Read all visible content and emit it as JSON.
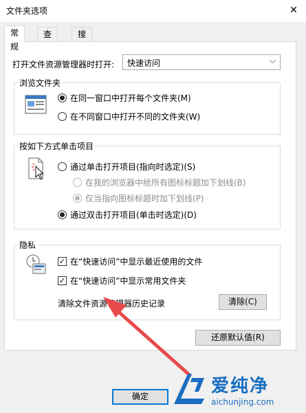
{
  "window": {
    "title": "文件夹选项",
    "close_glyph": "✕"
  },
  "tabs": [
    {
      "label": "常规",
      "active": true
    },
    {
      "label": "查看",
      "active": false
    },
    {
      "label": "搜索",
      "active": false
    }
  ],
  "open_with": {
    "label": "打开文件资源管理器时打开:",
    "value": "快速访问",
    "chevron": "⌵"
  },
  "browse": {
    "legend": "浏览文件夹",
    "same_window": "在同一窗口中打开每个文件夹(M)",
    "new_window": "在不同窗口中打开不同的文件夹(W)"
  },
  "click": {
    "legend": "按如下方式单击项目",
    "single": "通过单击打开项目(指向时选定)(S)",
    "underline_browser": "在我的浏览器中给所有图标标题加下划线(B)",
    "underline_point": "仅当指向图标标题时加下划线(P)",
    "double": "通过双击打开项目(单击时选定)(D)"
  },
  "privacy": {
    "legend": "隐私",
    "recent_files": "在“快速访问”中显示最近使用的文件",
    "frequent_folders": "在“快速访问”中显示常用文件夹",
    "clear_label": "清除文件资源管理器历史记录",
    "clear_button": "清除(C)"
  },
  "restore_button": "还原默认值(R)",
  "ok_button": "确定",
  "watermark": {
    "name": "爱纯净",
    "url": "aichunjing.com"
  },
  "colors": {
    "arrow": "#e84a4a",
    "accent": "#0078d7"
  }
}
